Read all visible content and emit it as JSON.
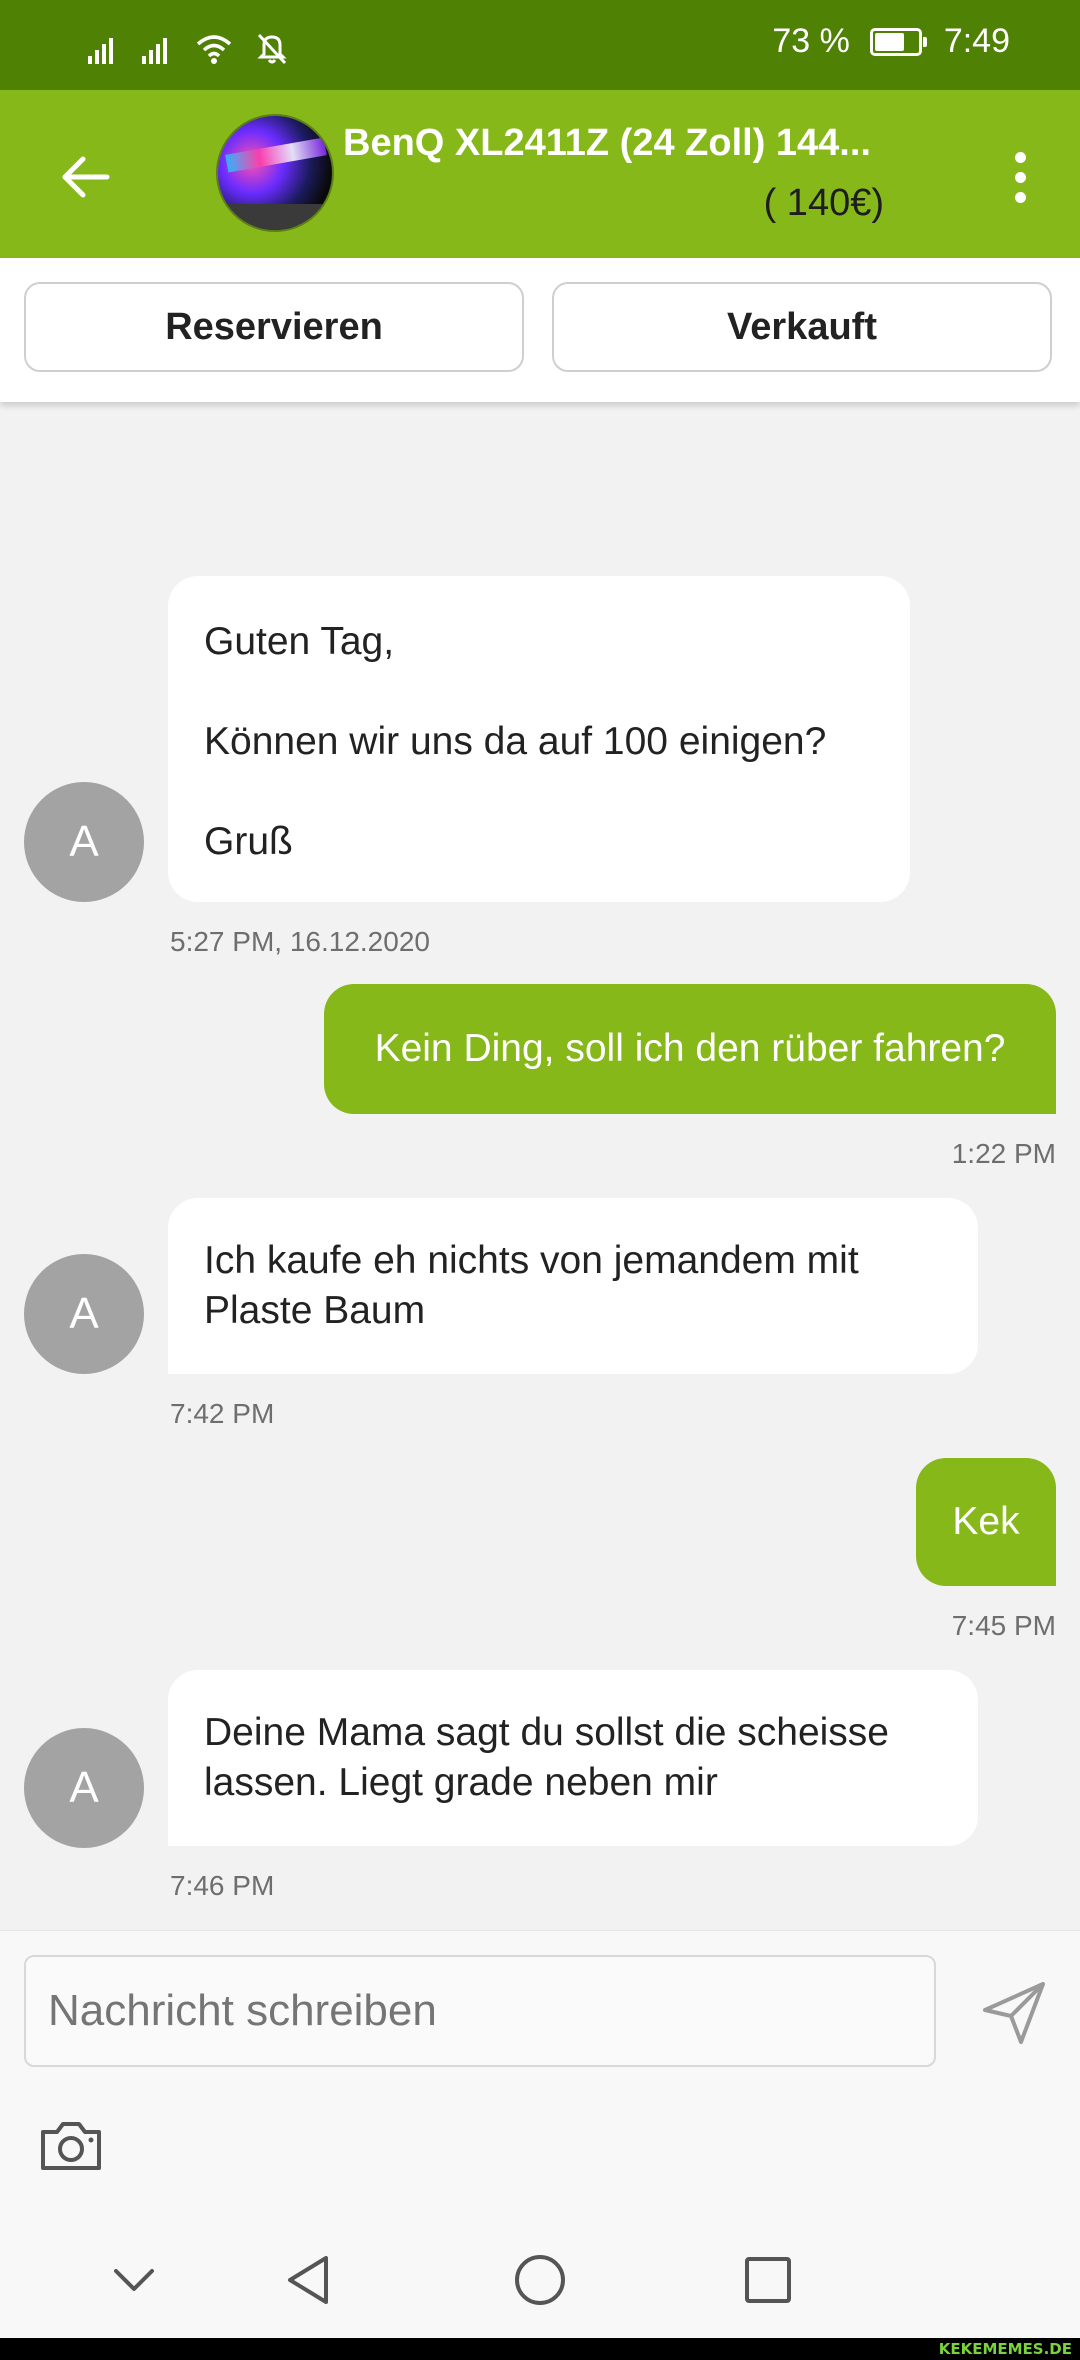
{
  "status_bar": {
    "battery_text": "73 %",
    "battery_level": 0.73,
    "time": "7:49",
    "icons": [
      "signal-icon",
      "signal-icon",
      "wifi-icon",
      "bell-off-icon"
    ]
  },
  "header": {
    "title": "BenQ XL2411Z (24 Zoll) 144...",
    "price": "( 140€)",
    "back_icon": "arrow-left-icon",
    "menu_icon": "more-vertical-icon"
  },
  "actions": {
    "reserve_label": "Reservieren",
    "sold_label": "Verkauft"
  },
  "messages": [
    {
      "direction": "incoming",
      "avatar": "A",
      "lines": [
        "Guten Tag,",
        "",
        "Können wir uns da auf 100 einigen?",
        "",
        "Gruß"
      ],
      "time": "5:27 PM, 16.12.2020"
    },
    {
      "direction": "outgoing",
      "text": "Kein Ding, soll ich den rüber fahren?",
      "time": "1:22 PM"
    },
    {
      "direction": "incoming",
      "avatar": "A",
      "lines": [
        "Ich kaufe eh nichts von jemandem mit",
        "Plaste Baum"
      ],
      "time": "7:42 PM"
    },
    {
      "direction": "outgoing",
      "text": "Kek",
      "time": "7:45 PM"
    },
    {
      "direction": "incoming",
      "avatar": "A",
      "lines": [
        "Deine Mama sagt du sollst die scheisse",
        "lassen. Liegt grade neben mir"
      ],
      "time": "7:46 PM"
    }
  ],
  "composer": {
    "placeholder": "Nachricht schreiben",
    "send_icon": "send-icon",
    "camera_icon": "camera-icon"
  },
  "nav_bar": {
    "icons": [
      "chevron-down-icon",
      "back-triangle-icon",
      "home-circle-icon",
      "recents-square-icon"
    ]
  },
  "watermark": "KEKEMEMES.DE",
  "colors": {
    "status_bar": "#4f8104",
    "accent": "#86b81a",
    "background": "#f2f2f2",
    "avatar": "#a3a3a3"
  }
}
